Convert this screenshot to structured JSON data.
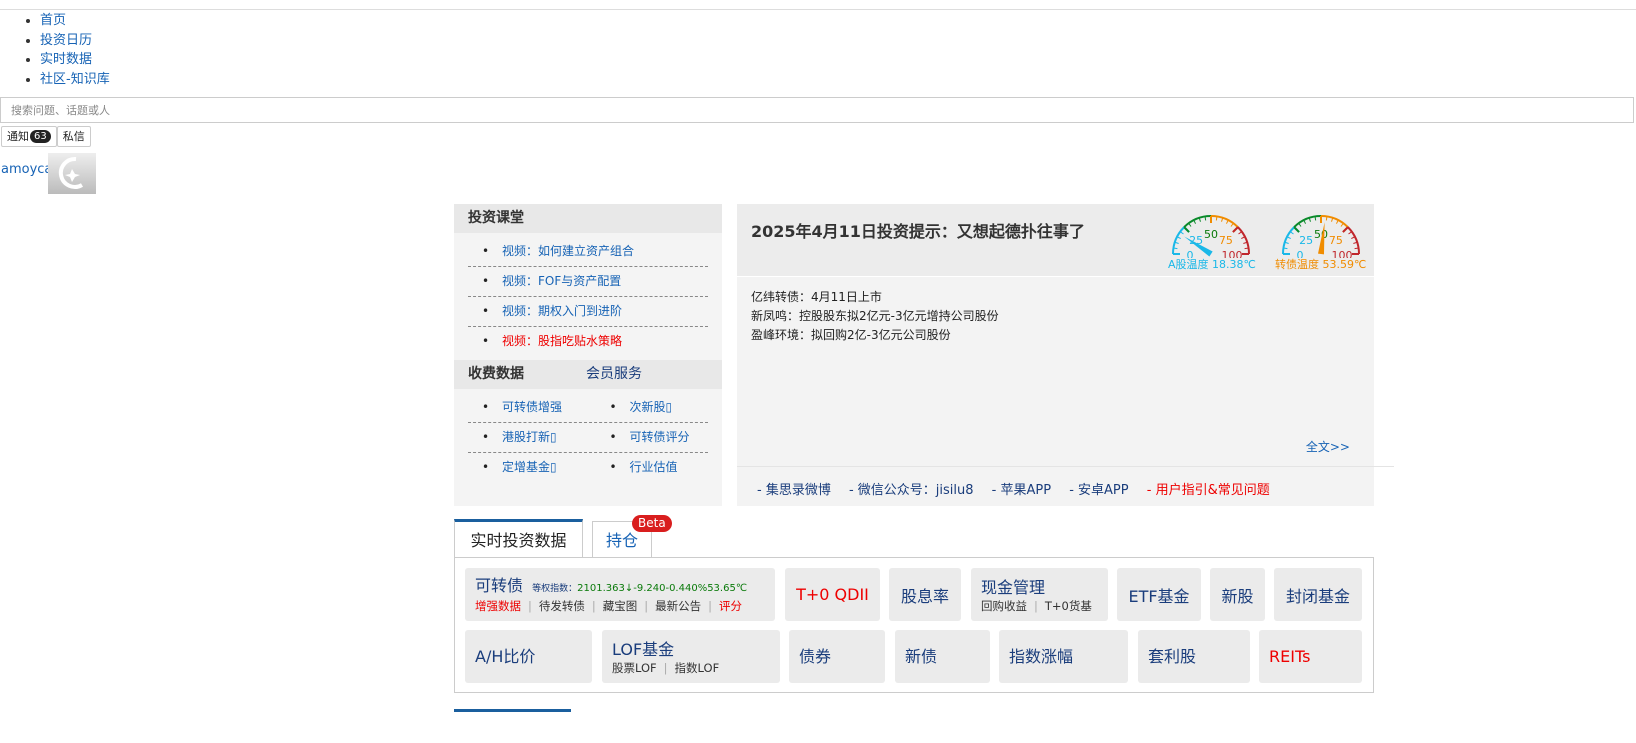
{
  "nav": [
    "首页",
    "投资日历",
    "实时数据",
    "社区-知识库"
  ],
  "search": {
    "placeholder": "搜索问题、话题或人"
  },
  "header": {
    "notify": "通知",
    "notify_count": "63",
    "message": "私信",
    "username": "amoyca"
  },
  "left": {
    "course_title": "投资课堂",
    "courses": [
      {
        "label": "视频：如何建立资产组合"
      },
      {
        "label": "视频：FOF与资产配置"
      },
      {
        "label": "视频：期权入门到进阶"
      },
      {
        "label": "视频：股指吃贴水策略",
        "highlight": true
      }
    ],
    "paid_title": "收费数据",
    "member": "会员服务",
    "paid": [
      "可转债增强",
      "次新股▯",
      "港股打新▯",
      "可转债评分",
      "定增基金▯",
      "行业估值"
    ]
  },
  "tip": {
    "title": "2025年4月11日投资提示：又想起德扑往事了",
    "news": [
      "亿纬转债：4月11日上市",
      "新凤鸣：控股股东拟2亿元-3亿元增持公司股份",
      "盈峰环境：拟回购2亿-3亿元公司股份"
    ],
    "full": "全文>>",
    "links": [
      "- 集思录微博",
      "- 微信公众号：jisilu8",
      "- 苹果APP",
      "- 安卓APP",
      "- 用户指引&常见问题"
    ],
    "gauges": [
      {
        "label": "A股温度 18.38℃",
        "value": 18.38,
        "color": "#1ab8e8"
      },
      {
        "label": "转债温度 53.59℃",
        "value": 53.59,
        "color": "#f08c00"
      }
    ],
    "gauge_ticks": [
      "0",
      "25",
      "50",
      "75",
      "100"
    ]
  },
  "tabs": {
    "realtime": "实时投资数据",
    "holdings": "持仓",
    "beta": "Beta"
  },
  "cb": {
    "title": "可转债",
    "index_label": "等权指数：",
    "index_value": "2101.363↓-9.240-0.440%53.65℃",
    "links": [
      "增强数据",
      "待发转债",
      "藏宝图",
      "最新公告",
      "评分"
    ]
  },
  "cells": {
    "qdii": "T+0 QDII",
    "dividend": "股息率",
    "cash": "现金管理",
    "cash_sub": [
      "回购收益",
      "T+0货基"
    ],
    "etf": "ETF基金",
    "ipo": "新股",
    "closed": "封闭基金",
    "ah": "A/H比价",
    "lof": "LOF基金",
    "lof_sub": [
      "股票LOF",
      "指数LOF"
    ],
    "bond": "债券",
    "newbond": "新债",
    "index": "指数涨幅",
    "arb": "套利股",
    "reits": "REITs"
  }
}
